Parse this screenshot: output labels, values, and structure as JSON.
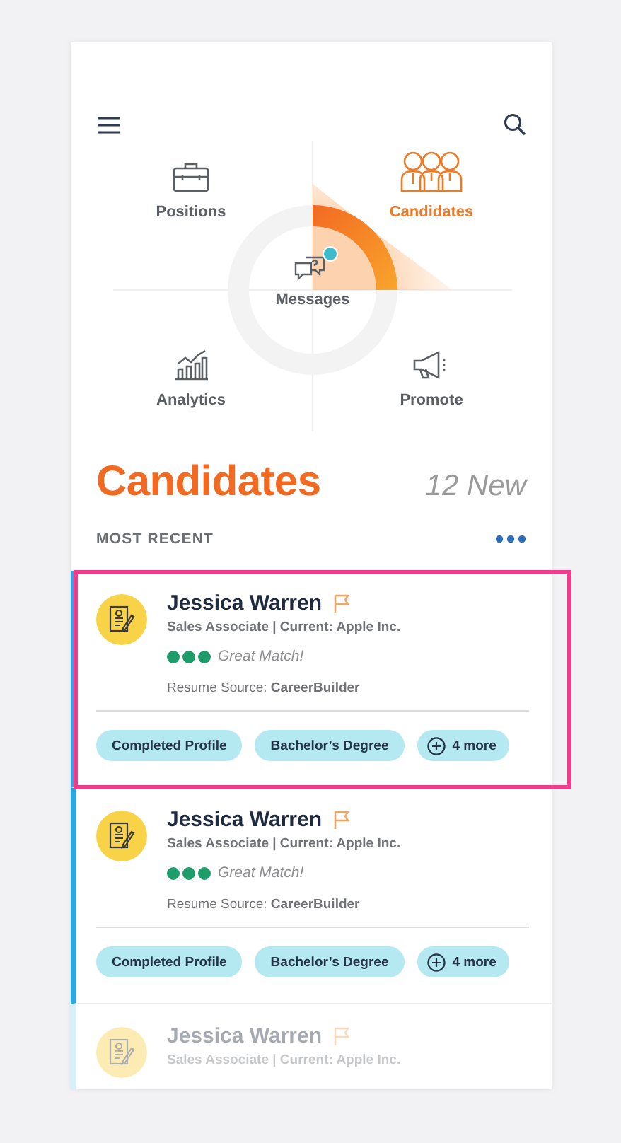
{
  "quadrants": [
    {
      "label": "Positions",
      "selected": false
    },
    {
      "label": "Candidates",
      "selected": true
    },
    {
      "label": "Analytics",
      "selected": false
    },
    {
      "label": "Promote",
      "selected": false
    }
  ],
  "center_item": {
    "label": "Messages",
    "badge": true
  },
  "heading": "Candidates",
  "new_count": "12 New",
  "section_label": "MOST RECENT",
  "candidates": [
    {
      "name": "Jessica Warren",
      "title": "Sales Associate | Current: Apple Inc.",
      "stars": 3,
      "match_text": "Great Match!",
      "source_label": "Resume Source:",
      "source": "CareerBuilder",
      "tags": [
        "Completed Profile",
        "Bachelor’s Degree"
      ],
      "more": "4 more",
      "flagged": true,
      "highlighted": true,
      "faded": false
    },
    {
      "name": "Jessica Warren",
      "title": "Sales Associate | Current: Apple Inc.",
      "stars": 3,
      "match_text": "Great Match!",
      "source_label": "Resume Source:",
      "source": "CareerBuilder",
      "tags": [
        "Completed Profile",
        "Bachelor’s Degree"
      ],
      "more": "4 more",
      "flagged": true,
      "highlighted": false,
      "faded": false
    },
    {
      "name": "Jessica Warren",
      "title": "Sales Associate | Current: Apple Inc.",
      "flagged": true,
      "highlighted": false,
      "faded": true
    }
  ]
}
